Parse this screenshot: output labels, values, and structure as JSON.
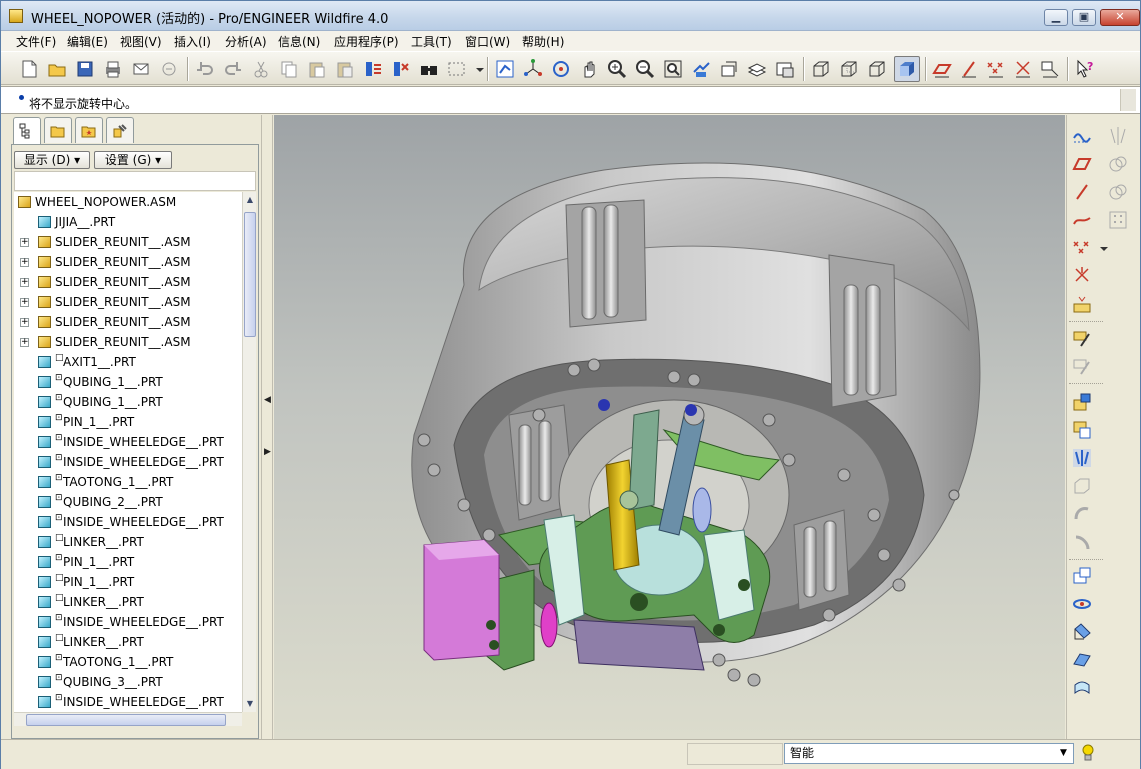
{
  "window": {
    "title": "WHEEL_NOPOWER (活动的) - Pro/ENGINEER Wildfire 4.0",
    "controls": [
      "minimize",
      "maximize",
      "close"
    ]
  },
  "menu": [
    "文件(F)",
    "编辑(E)",
    "视图(V)",
    "插入(I)",
    "分析(A)",
    "信息(N)",
    "应用程序(P)",
    "工具(T)",
    "窗口(W)",
    "帮助(H)"
  ],
  "message": {
    "text": "将不显示旋转中心。"
  },
  "left_panel": {
    "tabs": [
      "model-tree",
      "folder-browser",
      "favorites",
      "connections"
    ],
    "show_label": "显示 (D)",
    "settings_label": "设置 (G)",
    "tree": [
      {
        "label": "WHEEL_NOPOWER.ASM",
        "type": "asm",
        "level": 0,
        "expand": false,
        "mark": ""
      },
      {
        "label": "JIJIA__.PRT",
        "type": "prt",
        "level": 1,
        "expand": false,
        "mark": ""
      },
      {
        "label": "SLIDER_REUNIT__.ASM",
        "type": "asm",
        "level": 1,
        "expand": true,
        "mark": ""
      },
      {
        "label": "SLIDER_REUNIT__.ASM",
        "type": "asm",
        "level": 1,
        "expand": true,
        "mark": ""
      },
      {
        "label": "SLIDER_REUNIT__.ASM",
        "type": "asm",
        "level": 1,
        "expand": true,
        "mark": ""
      },
      {
        "label": "SLIDER_REUNIT__.ASM",
        "type": "asm",
        "level": 1,
        "expand": true,
        "mark": ""
      },
      {
        "label": "SLIDER_REUNIT__.ASM",
        "type": "asm",
        "level": 1,
        "expand": true,
        "mark": ""
      },
      {
        "label": "SLIDER_REUNIT__.ASM",
        "type": "asm",
        "level": 1,
        "expand": true,
        "mark": ""
      },
      {
        "label": "AXIT1__.PRT",
        "type": "prt",
        "level": 1,
        "expand": false,
        "mark": "□"
      },
      {
        "label": "QUBING_1__.PRT",
        "type": "prt",
        "level": 1,
        "expand": false,
        "mark": "⊡"
      },
      {
        "label": "QUBING_1__.PRT",
        "type": "prt",
        "level": 1,
        "expand": false,
        "mark": "⊡"
      },
      {
        "label": "PIN_1__.PRT",
        "type": "prt",
        "level": 1,
        "expand": false,
        "mark": "⊡"
      },
      {
        "label": "INSIDE_WHEELEDGE__.PRT",
        "type": "prt",
        "level": 1,
        "expand": false,
        "mark": "⊡"
      },
      {
        "label": "INSIDE_WHEELEDGE__.PRT",
        "type": "prt",
        "level": 1,
        "expand": false,
        "mark": "⊡"
      },
      {
        "label": "TAOTONG_1__.PRT",
        "type": "prt",
        "level": 1,
        "expand": false,
        "mark": "⊡"
      },
      {
        "label": "QUBING_2__.PRT",
        "type": "prt",
        "level": 1,
        "expand": false,
        "mark": "⊡"
      },
      {
        "label": "INSIDE_WHEELEDGE__.PRT",
        "type": "prt",
        "level": 1,
        "expand": false,
        "mark": "⊡"
      },
      {
        "label": "LINKER__.PRT",
        "type": "prt",
        "level": 1,
        "expand": false,
        "mark": "□"
      },
      {
        "label": "PIN_1__.PRT",
        "type": "prt",
        "level": 1,
        "expand": false,
        "mark": "⊡"
      },
      {
        "label": "PIN_1__.PRT",
        "type": "prt",
        "level": 1,
        "expand": false,
        "mark": "□"
      },
      {
        "label": "LINKER__.PRT",
        "type": "prt",
        "level": 1,
        "expand": false,
        "mark": "□"
      },
      {
        "label": "INSIDE_WHEELEDGE__.PRT",
        "type": "prt",
        "level": 1,
        "expand": false,
        "mark": "⊡"
      },
      {
        "label": "LINKER__.PRT",
        "type": "prt",
        "level": 1,
        "expand": false,
        "mark": "□"
      },
      {
        "label": "TAOTONG_1__.PRT",
        "type": "prt",
        "level": 1,
        "expand": false,
        "mark": "⊡"
      },
      {
        "label": "QUBING_3__.PRT",
        "type": "prt",
        "level": 1,
        "expand": false,
        "mark": "⊡"
      },
      {
        "label": "INSIDE_WHEELEDGE__.PRT",
        "type": "prt",
        "level": 1,
        "expand": false,
        "mark": "⊡"
      }
    ]
  },
  "status": {
    "filter_value": "智能"
  },
  "colors": {
    "gray_shell": "#b9b9b9",
    "green_part": "#5f9b54",
    "magenta_part": "#d47ad8",
    "yellow_shaft": "#d8b400",
    "cyan_part": "#b8e0dc",
    "background_top": "#9ea3a6",
    "background_bottom": "#dcdccd"
  }
}
